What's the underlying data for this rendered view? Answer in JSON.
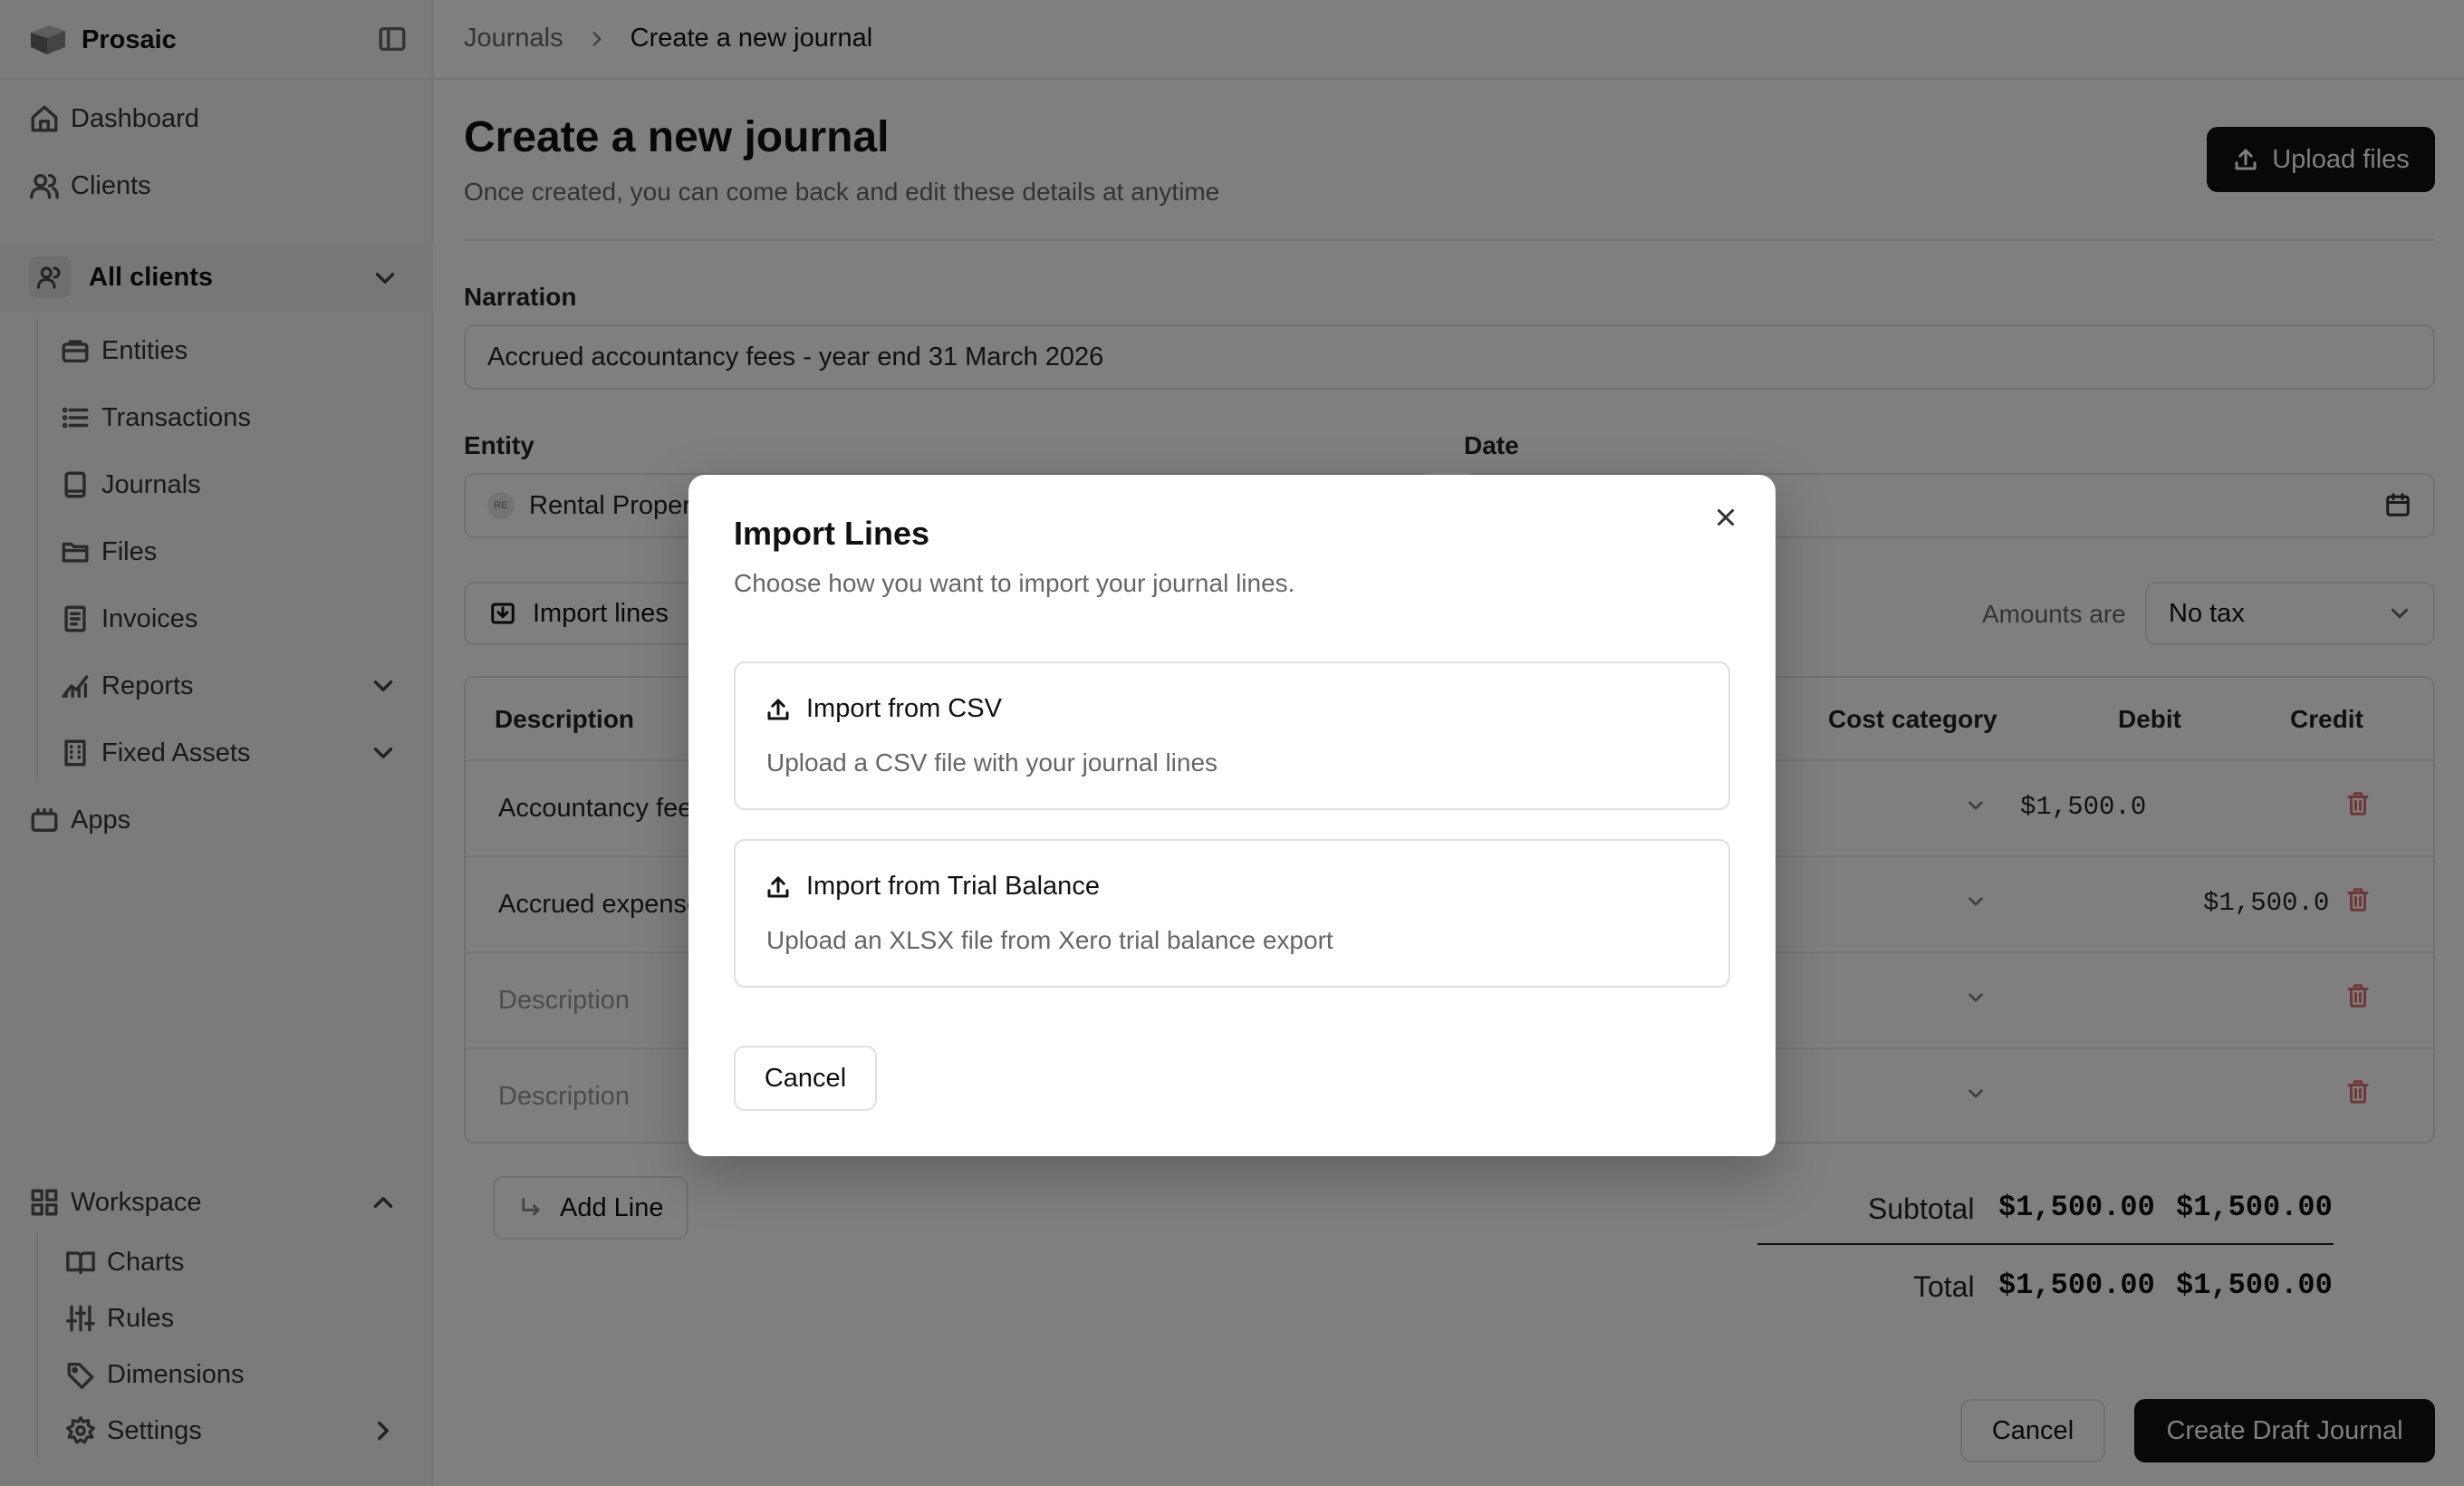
{
  "sidebar": {
    "brand": "Prosaic",
    "nav": {
      "dashboard": "Dashboard",
      "clients": "Clients"
    },
    "client_selector": "All clients",
    "client_items": {
      "entities": "Entities",
      "transactions": "Transactions",
      "journals": "Journals",
      "files": "Files",
      "invoices": "Invoices",
      "reports": "Reports",
      "fixed_assets": "Fixed Assets"
    },
    "apps": "Apps",
    "workspace": {
      "label": "Workspace",
      "charts": "Charts",
      "rules": "Rules",
      "dimensions": "Dimensions",
      "settings": "Settings"
    }
  },
  "breadcrumb": {
    "parent": "Journals",
    "current": "Create a new journal"
  },
  "header": {
    "title": "Create a new journal",
    "subtitle": "Once created, you can come back and edit these details at anytime",
    "upload_label": "Upload files"
  },
  "form": {
    "narration_label": "Narration",
    "narration_value": "Accrued accountancy fees - year end 31 March 2026",
    "entity_label": "Entity",
    "entity_chip": "RE",
    "entity_value": "Rental Proper",
    "date_label": "Date",
    "import_label": "Import lines",
    "amounts_label": "Amounts are",
    "tax_value": "No tax"
  },
  "table": {
    "columns": {
      "description": "Description",
      "cost_category": "Cost category",
      "debit": "Debit",
      "credit": "Credit"
    },
    "rows": [
      {
        "description": "Accountancy fee",
        "debit": "$1,500.0",
        "credit": ""
      },
      {
        "description": "Accrued expense",
        "debit": "",
        "credit": "$1,500.0"
      },
      {
        "description": "Description",
        "debit": "",
        "credit": ""
      },
      {
        "description": "Description",
        "debit": "",
        "credit": ""
      }
    ]
  },
  "add_line_label": "Add Line",
  "totals": {
    "subtotal_label": "Subtotal",
    "subtotal_debit": "$1,500.00",
    "subtotal_credit": "$1,500.00",
    "total_label": "Total",
    "total_debit": "$1,500.00",
    "total_credit": "$1,500.00"
  },
  "footer": {
    "cancel": "Cancel",
    "create": "Create Draft Journal"
  },
  "modal": {
    "title": "Import Lines",
    "subtitle": "Choose how you want to import your journal lines.",
    "options": [
      {
        "title": "Import from CSV",
        "description": "Upload a CSV file with your journal lines"
      },
      {
        "title": "Import from Trial Balance",
        "description": "Upload an XLSX file from Xero trial balance export"
      }
    ],
    "cancel": "Cancel"
  }
}
